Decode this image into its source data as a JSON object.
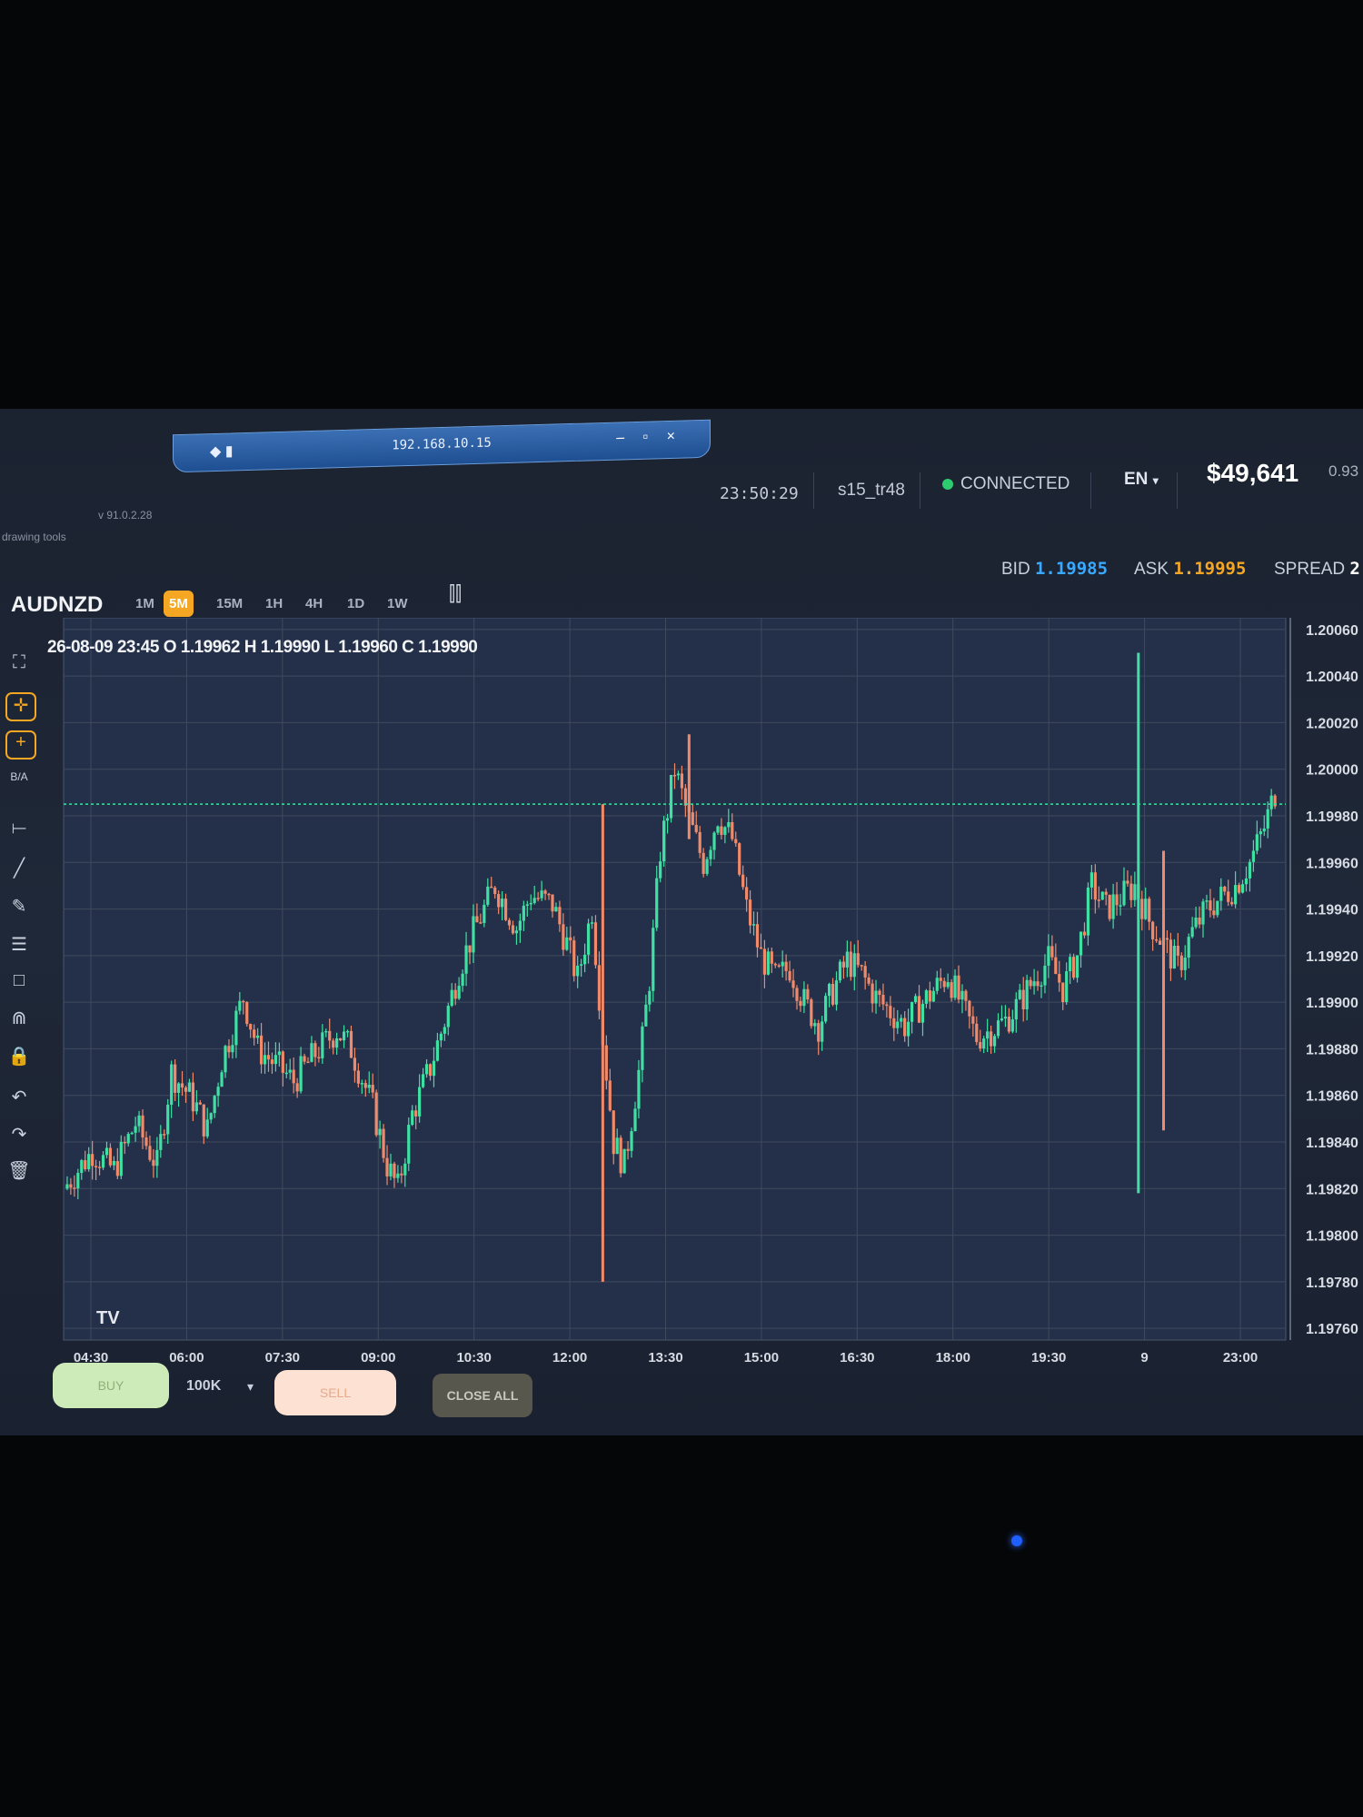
{
  "window": {
    "remote_ip": "192.168.10.15",
    "pin_glyph": "◆ ▮",
    "controls": "– ▫ ×"
  },
  "app": {
    "version": "v 91.0.2.28",
    "drawing_tools": "drawing tools"
  },
  "status": {
    "clock": "23:50:29",
    "account": "s15_tr48",
    "connection": "CONNECTED",
    "language": "EN",
    "language_caret": "▾",
    "balance": "$49,641",
    "extra": "0.93"
  },
  "quote": {
    "bid_label": "BID",
    "bid": "1.19985",
    "ask_label": "ASK",
    "ask": "1.19995",
    "spread_label": "SPREAD",
    "spread": "2"
  },
  "symbol": "AUDNZD",
  "timeframes": [
    "1M",
    "5M",
    "15M",
    "1H",
    "4H",
    "1D",
    "1W"
  ],
  "active_timeframe": "5M",
  "left_tools": [
    {
      "name": "fullscreen-icon",
      "glyph": "⛶"
    },
    {
      "name": "crosshair-icon",
      "glyph": "✛"
    },
    {
      "name": "add-indicator-icon",
      "glyph": "+"
    },
    {
      "name": "ba-toggle",
      "glyph": "B/A"
    },
    {
      "name": "horizontal-line-icon",
      "glyph": "⟝"
    },
    {
      "name": "trend-line-icon",
      "glyph": "╱"
    },
    {
      "name": "pencil-icon",
      "glyph": "✎"
    },
    {
      "name": "fibonacci-icon",
      "glyph": "☰"
    },
    {
      "name": "rectangle-icon",
      "glyph": "□"
    },
    {
      "name": "magnet-icon",
      "glyph": "⋒"
    },
    {
      "name": "lock-icon",
      "glyph": "🔒"
    },
    {
      "name": "undo-icon",
      "glyph": "↶"
    },
    {
      "name": "redo-icon",
      "glyph": "↷"
    },
    {
      "name": "trash-icon",
      "glyph": "🗑"
    }
  ],
  "ohlc_text": "26-08-09 23:45 O 1.19962 H 1.19990 L 1.19960 C 1.19990",
  "chart_logo": "TV",
  "chart_data": {
    "type": "candlestick",
    "x_ticks": [
      "04:30",
      "06:00",
      "07:30",
      "09:00",
      "10:30",
      "12:00",
      "13:30",
      "15:00",
      "16:30",
      "18:00",
      "19:30",
      "9",
      "23:00"
    ],
    "y_ticks": [
      "1.20060",
      "1.20040",
      "1.20020",
      "1.20000",
      "1.19980",
      "1.19960",
      "1.19940",
      "1.19920",
      "1.19900",
      "1.19880",
      "1.19860",
      "1.19840",
      "1.19820",
      "1.19800",
      "1.19780",
      "1.19760"
    ],
    "ylim": [
      1.19755,
      1.20065
    ],
    "price_line": 1.19985,
    "colors": {
      "up": "#3fe0a4",
      "down": "#f08a6a",
      "price_line": "#3fe0a4",
      "grid": "#3f4a5e"
    },
    "path": [
      [
        0,
        1.1982
      ],
      [
        8,
        1.19836
      ],
      [
        14,
        1.19828
      ],
      [
        20,
        1.19848
      ],
      [
        26,
        1.1983
      ],
      [
        30,
        1.1987
      ],
      [
        36,
        1.19858
      ],
      [
        40,
        1.19845
      ],
      [
        44,
        1.19875
      ],
      [
        50,
        1.19902
      ],
      [
        54,
        1.1988
      ],
      [
        60,
        1.19872
      ],
      [
        64,
        1.19866
      ],
      [
        70,
        1.19878
      ],
      [
        76,
        1.19888
      ],
      [
        80,
        1.1988
      ],
      [
        86,
        1.19855
      ],
      [
        90,
        1.1983
      ],
      [
        93,
        1.1982
      ],
      [
        97,
        1.19852
      ],
      [
        102,
        1.19872
      ],
      [
        106,
        1.19892
      ],
      [
        110,
        1.19914
      ],
      [
        114,
        1.1993
      ],
      [
        120,
        1.1995
      ],
      [
        126,
        1.19932
      ],
      [
        130,
        1.19946
      ],
      [
        136,
        1.19942
      ],
      [
        140,
        1.19925
      ],
      [
        143,
        1.1991
      ],
      [
        147,
        1.1994
      ],
      [
        150,
        1.19885
      ],
      [
        153,
        1.1984
      ],
      [
        156,
        1.1983
      ],
      [
        160,
        1.1987
      ],
      [
        163,
        1.1991
      ],
      [
        166,
        1.19965
      ],
      [
        170,
        1.2
      ],
      [
        174,
        1.19978
      ],
      [
        178,
        1.1996
      ],
      [
        182,
        1.1998
      ],
      [
        186,
        1.1997
      ],
      [
        190,
        1.1994
      ],
      [
        194,
        1.1992
      ],
      [
        198,
        1.1991
      ],
      [
        202,
        1.19915
      ],
      [
        206,
        1.199
      ],
      [
        210,
        1.1989
      ],
      [
        214,
        1.19905
      ],
      [
        218,
        1.19918
      ],
      [
        222,
        1.19912
      ],
      [
        226,
        1.19902
      ],
      [
        230,
        1.19896
      ],
      [
        234,
        1.1989
      ],
      [
        238,
        1.19898
      ],
      [
        242,
        1.19905
      ],
      [
        246,
        1.19912
      ],
      [
        250,
        1.19898
      ],
      [
        254,
        1.19885
      ],
      [
        258,
        1.19888
      ],
      [
        262,
        1.19892
      ],
      [
        266,
        1.199
      ],
      [
        270,
        1.1991
      ],
      [
        274,
        1.19918
      ],
      [
        278,
        1.19906
      ],
      [
        282,
        1.1992
      ],
      [
        286,
        1.1995
      ],
      [
        290,
        1.1994
      ],
      [
        294,
        1.19945
      ],
      [
        298,
        1.1995
      ],
      [
        302,
        1.19935
      ],
      [
        306,
        1.19925
      ],
      [
        310,
        1.19915
      ],
      [
        314,
        1.1993
      ],
      [
        318,
        1.1994
      ],
      [
        322,
        1.19945
      ],
      [
        326,
        1.1995
      ],
      [
        330,
        1.1996
      ],
      [
        334,
        1.19975
      ],
      [
        337,
        1.1999
      ]
    ],
    "spikes": [
      {
        "pos": 150,
        "high": 1.19985,
        "low": 1.1978,
        "dir": "down"
      },
      {
        "pos": 174,
        "high": 1.20015,
        "low": 1.1997,
        "dir": "down"
      },
      {
        "pos": 299,
        "high": 1.2005,
        "low": 1.19818,
        "dir": "up"
      },
      {
        "pos": 306,
        "high": 1.19965,
        "low": 1.19845,
        "dir": "down"
      }
    ]
  },
  "order_panel": {
    "buy_label": "BUY",
    "quantity": "100K",
    "quantity_caret": "▾",
    "sell_label": "SELL",
    "close_all_label": "CLOSE ALL"
  }
}
